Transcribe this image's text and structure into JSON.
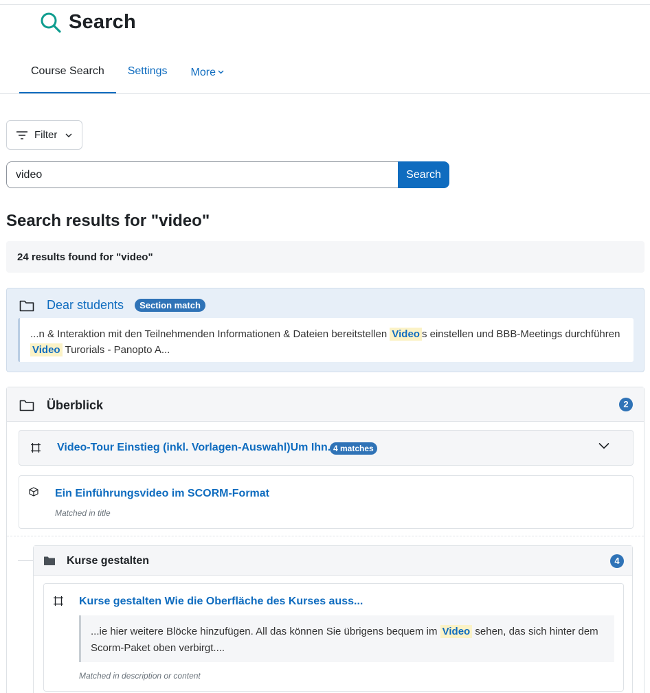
{
  "page": {
    "title": "Search",
    "icon": "search-icon"
  },
  "tabs": [
    {
      "label": "Course Search",
      "active": true
    },
    {
      "label": "Settings",
      "active": false
    },
    {
      "label": "More",
      "active": false,
      "icon": "chevron-down-icon"
    }
  ],
  "filter": {
    "label": "Filter",
    "icon": "filter-lines-icon",
    "chevron": "chevron-down-icon"
  },
  "search": {
    "value": "video",
    "button_label": "Search"
  },
  "results": {
    "heading": "Search results for \"video\"",
    "summary": "24 results found for \"video\"",
    "colors": {
      "link": "#0f6cbf",
      "badge": "#2f73b7",
      "highlight_bg": "#fbf2c6",
      "section_match_bg": "#e7eff8"
    },
    "section_match": {
      "icon": "folder-outline-icon",
      "title": "Dear students",
      "badge": "Section match",
      "excerpt_before": "...n & Interaktion mit den Teilnehmenden Informationen & Dateien bereitstellen",
      "highlight1": "Video",
      "excerpt_mid": "s einstellen und BBB-Meetings durchführen",
      "highlight2": "Video",
      "excerpt_after": "Turorials - Panopto A..."
    },
    "overview": {
      "icon": "folder-outline-icon",
      "title": "Überblick",
      "count": "2",
      "items": [
        {
          "icon": "page-resource-icon",
          "title": "Video-Tour Einstieg (inkl. Vorlagen-Auswahl)Um Ihn...",
          "badge": "4 matches",
          "expand_icon": "chevron-down-icon"
        },
        {
          "icon": "scorm-package-icon",
          "title": "Ein Einführungsvideo im SCORM-Format",
          "meta": "Matched in title"
        }
      ],
      "subsection": {
        "icon": "folder-filled-icon",
        "title": "Kurse gestalten",
        "count": "4",
        "item": {
          "icon": "page-resource-icon",
          "title": "Kurse gestalten Wie die Oberfläche des Kurses auss...",
          "excerpt_before": "...ie hier weitere Blöcke hinzufügen.   All das können Sie übrigens bequem im",
          "highlight": "Video",
          "excerpt_after": "sehen, das sich hinter dem Scorm-Paket oben verbirgt....",
          "meta": "Matched in description or content"
        }
      }
    }
  }
}
